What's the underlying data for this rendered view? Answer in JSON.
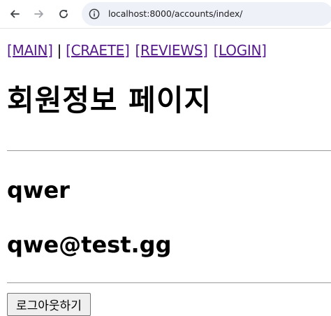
{
  "browser": {
    "url": "localhost:8000/accounts/index/"
  },
  "nav": {
    "main": "[MAIN]",
    "separator": "|",
    "create": "[CRAETE]",
    "reviews": "[REVIEWS]",
    "login": "[LOGIN]"
  },
  "page": {
    "title": "회원정보 페이지",
    "username": "qwer",
    "email": "qwe@test.gg",
    "logout_label": "로그아웃하기"
  },
  "colors": {
    "link": "#551a8b",
    "address_bar": "#eef1f8"
  }
}
